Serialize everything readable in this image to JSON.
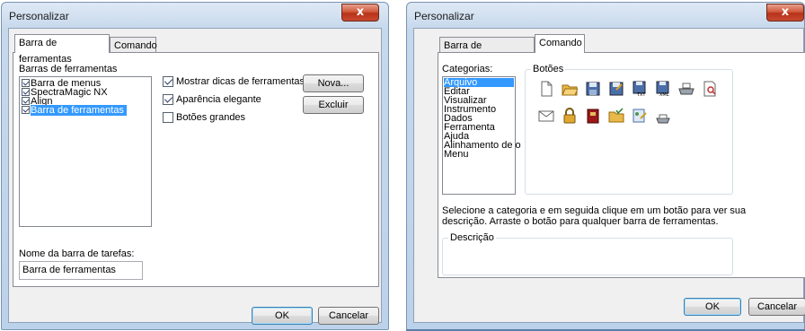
{
  "dialog1": {
    "title": "Personalizar",
    "close_glyph": "x",
    "tabs": [
      "Barra de ferramentas",
      "Comando"
    ],
    "toolbars_label": "Barras de ferramentas",
    "toolbar_items": [
      {
        "label": "Barra de menus",
        "checked": true
      },
      {
        "label": "SpectraMagic NX",
        "checked": true
      },
      {
        "label": "Align",
        "checked": true
      },
      {
        "label": "Barra de ferramentas",
        "checked": true,
        "selected": true
      }
    ],
    "options": [
      {
        "label": "Mostrar dicas de ferramentas",
        "checked": true
      },
      {
        "label": "Aparência elegante",
        "checked": true
      },
      {
        "label": "Botões grandes",
        "checked": false
      }
    ],
    "new_button": "Nova...",
    "delete_button": "Excluir",
    "name_label": "Nome  da barra de tarefas:",
    "name_value": "Barra de ferramentas",
    "ok_button": "OK",
    "cancel_button": "Cancelar"
  },
  "dialog2": {
    "title": "Personalizar",
    "close_glyph": "x",
    "tabs": [
      "Barra de ferramentas",
      "Comando"
    ],
    "categories_label": "Categorias:",
    "categories": [
      "Arquivo",
      "Editar",
      "Visualizar",
      "Instrumento",
      "Dados",
      "Ferramenta",
      "Ajuda",
      "Alinhamento de o",
      "Menu"
    ],
    "selected_category": "Arquivo",
    "buttons_label": "Botões",
    "button_icons": [
      "new-file-icon",
      "open-folder-icon",
      "save-icon",
      "save-as-icon",
      "save-txt-icon",
      "save-xml-icon",
      "print-icon",
      "print-preview-icon",
      "email-icon",
      "lock-icon",
      "book-icon",
      "folder-check-icon",
      "template-icon",
      "printer-small-icon"
    ],
    "hint_line1": "Selecione a categoria e em seguida clique em um botão para ver sua",
    "hint_line2": "descrição. Arraste o botão para qualquer barra de ferramentas.",
    "description_label": "Descrição",
    "ok_button": "OK",
    "cancel_button": "Cancelar"
  },
  "colors": {
    "selection": "#3399ff",
    "close_button": "#c84a30",
    "dialog_frame": "#c2d6ea"
  }
}
